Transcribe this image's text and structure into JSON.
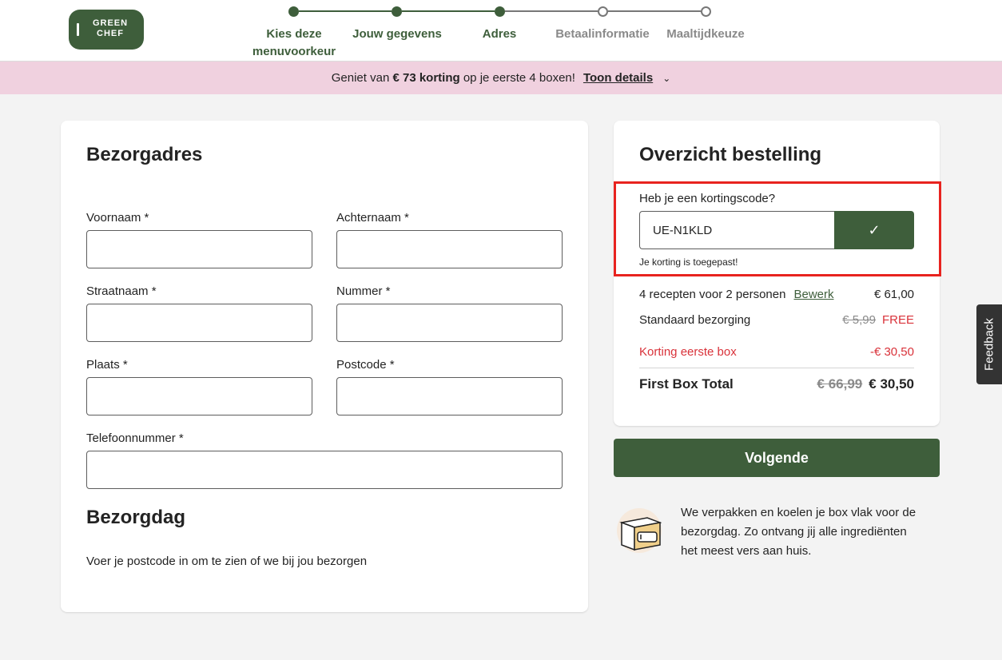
{
  "brand": {
    "logo_text": "GREEN CHEF",
    "primary_color": "#3e5e3b",
    "promo_bg": "#f0d1df",
    "error_color": "#e8231f"
  },
  "steps": [
    {
      "label": "Kies deze menuvoorkeur",
      "state": "done"
    },
    {
      "label": "Jouw gegevens",
      "state": "done"
    },
    {
      "label": "Adres",
      "state": "done"
    },
    {
      "label": "Betaalinformatie",
      "state": "todo"
    },
    {
      "label": "Maaltijdkeuze",
      "state": "todo"
    }
  ],
  "promo": {
    "prefix": "Geniet van",
    "amount": "€ 73 korting",
    "suffix": "op je eerste 4 boxen!",
    "link": "Toon details",
    "chevron_icon": "chevron-down-icon"
  },
  "address": {
    "title": "Bezorgadres",
    "fields": {
      "first_name": {
        "label": "Voornaam *",
        "value": ""
      },
      "last_name": {
        "label": "Achternaam *",
        "value": ""
      },
      "street": {
        "label": "Straatnaam *",
        "value": ""
      },
      "number": {
        "label": "Nummer *",
        "value": ""
      },
      "city": {
        "label": "Plaats *",
        "value": ""
      },
      "postcode": {
        "label": "Postcode *",
        "value": ""
      },
      "phone": {
        "label": "Telefoonnummer *",
        "value": ""
      }
    },
    "delivery_day_title": "Bezorgdag",
    "delivery_day_note": "Voer je postcode in om te zien of we bij jou bezorgen"
  },
  "summary": {
    "title": "Overzicht bestelling",
    "coupon_question": "Heb je een kortingscode?",
    "coupon_value": "UE-N1KLD",
    "coupon_applied": "Je korting is toegepast!",
    "recipes": {
      "label": "4 recepten voor 2 personen",
      "edit": "Bewerk",
      "price": "€ 61,00"
    },
    "shipping": {
      "label": "Standaard bezorging",
      "old_price": "€ 5,99",
      "price": "FREE"
    },
    "discount": {
      "label": "Korting eerste box",
      "price": "-€ 30,50"
    },
    "total": {
      "label": "First Box Total",
      "old_price": "€ 66,99",
      "price": "€ 30,50"
    }
  },
  "next_button": "Volgende",
  "info_text": "We verpakken en koelen je box vlak voor de bezorgdag. Zo ontvang jij alle ingrediënten het meest vers aan huis.",
  "feedback": "Feedback"
}
